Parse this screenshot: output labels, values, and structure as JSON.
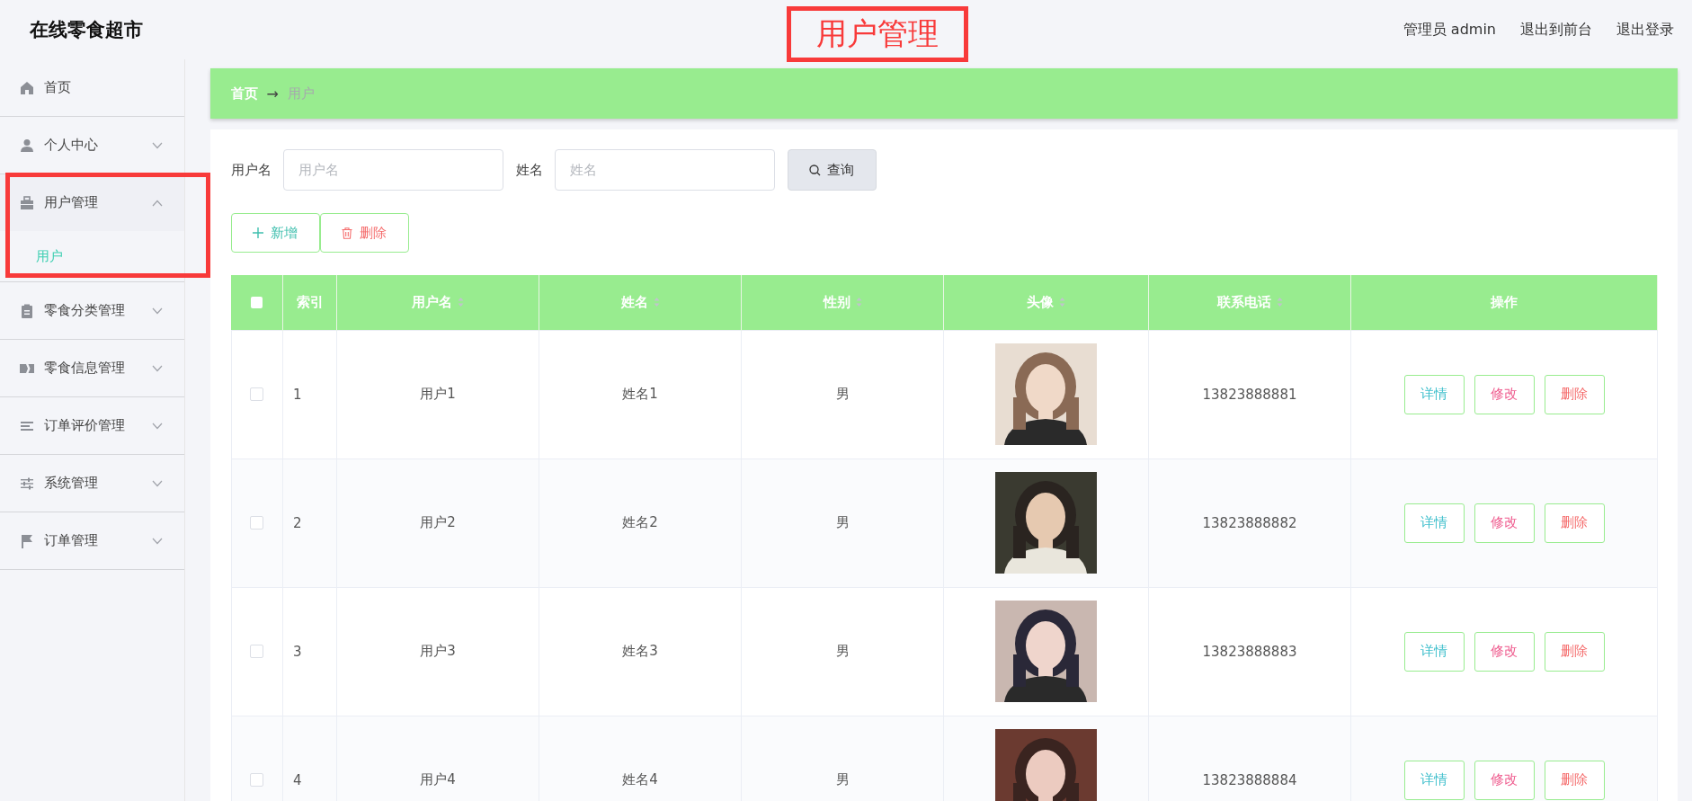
{
  "header": {
    "logo": "在线零食超市",
    "page_title": "用户管理",
    "links": [
      "管理员 admin",
      "退出到前台",
      "退出登录"
    ]
  },
  "sidebar": {
    "items": [
      {
        "label": "首页",
        "kind": "link"
      },
      {
        "label": "个人中心",
        "kind": "submenu",
        "expanded": false
      },
      {
        "label": "用户管理",
        "kind": "submenu",
        "expanded": true,
        "highlighted": true,
        "children": [
          {
            "label": "用户",
            "selected": true
          }
        ]
      },
      {
        "label": "零食分类管理",
        "kind": "submenu",
        "expanded": false
      },
      {
        "label": "零食信息管理",
        "kind": "submenu",
        "expanded": false
      },
      {
        "label": "订单评价管理",
        "kind": "submenu",
        "expanded": false
      },
      {
        "label": "系统管理",
        "kind": "submenu",
        "expanded": false
      },
      {
        "label": "订单管理",
        "kind": "submenu",
        "expanded": false
      }
    ]
  },
  "breadcrumb": {
    "home": "首页",
    "separator": "→",
    "current": "用户"
  },
  "search": {
    "fields": [
      {
        "label": "用户名",
        "placeholder": "用户名"
      },
      {
        "label": "姓名",
        "placeholder": "姓名"
      }
    ],
    "button": "查询"
  },
  "actions": [
    {
      "label": "新增",
      "kind": "add"
    },
    {
      "label": "删除",
      "kind": "delete"
    }
  ],
  "table": {
    "select_all_checked": false,
    "columns": [
      {
        "label": "索引",
        "sortable": false
      },
      {
        "label": "用户名",
        "sortable": true
      },
      {
        "label": "姓名",
        "sortable": true
      },
      {
        "label": "性别",
        "sortable": true
      },
      {
        "label": "头像",
        "sortable": true
      },
      {
        "label": "联系电话",
        "sortable": true
      },
      {
        "label": "操作",
        "sortable": false
      }
    ],
    "rows": [
      {
        "checked": false,
        "index": "1",
        "username": "用户1",
        "name": "姓名1",
        "gender": "男",
        "avatar": {
          "kind": "picture"
        },
        "phone": "13823888881",
        "buttons": [
          "详情",
          "修改",
          "删除"
        ]
      },
      {
        "checked": false,
        "index": "2",
        "username": "用户2",
        "name": "姓名2",
        "gender": "男",
        "avatar": {
          "kind": "picture"
        },
        "phone": "13823888882",
        "buttons": [
          "详情",
          "修改",
          "删除"
        ]
      },
      {
        "checked": false,
        "index": "3",
        "username": "用户3",
        "name": "姓名3",
        "gender": "男",
        "avatar": {
          "kind": "picture"
        },
        "phone": "13823888883",
        "buttons": [
          "详情",
          "修改",
          "删除"
        ]
      },
      {
        "checked": false,
        "index": "4",
        "username": "用户4",
        "name": "姓名4",
        "gender": "男",
        "avatar": {
          "kind": "picture"
        },
        "phone": "13823888884",
        "buttons": [
          "详情",
          "修改",
          "删除"
        ]
      }
    ]
  }
}
